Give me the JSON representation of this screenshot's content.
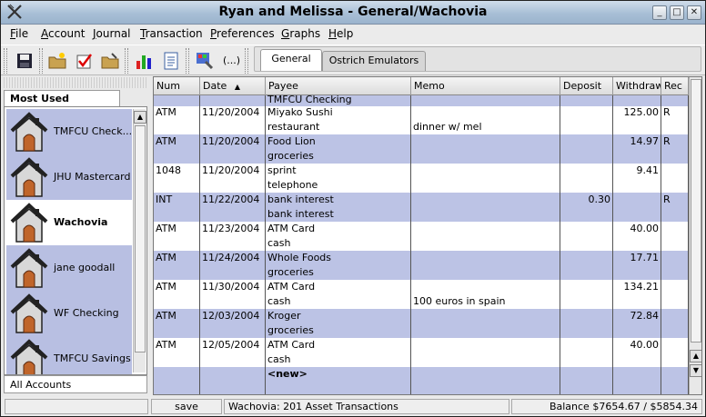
{
  "window": {
    "title": "Ryan and Melissa - General/Wachovia",
    "buttons": [
      "_",
      "□",
      "✕"
    ]
  },
  "menu": [
    {
      "label": "File",
      "u": "F",
      "rest": "ile"
    },
    {
      "label": "Account",
      "u": "A",
      "rest": "ccount"
    },
    {
      "label": "Journal",
      "u": "J",
      "rest": "ournal"
    },
    {
      "label": "Transaction",
      "u": "T",
      "rest": "ransaction"
    },
    {
      "label": "Preferences",
      "u": "P",
      "rest": "references"
    },
    {
      "label": "Graphs",
      "u": "G",
      "rest": "raphs"
    },
    {
      "label": "Help",
      "u": "H",
      "rest": "elp"
    }
  ],
  "toolbar": {
    "ellipsis": "(...)"
  },
  "tabs": [
    "General",
    "Ostrich Emulators"
  ],
  "sidebar": {
    "tab_label": "Most Used",
    "accounts": [
      "TMFCU Check...",
      "JHU Mastercard",
      "Wachovia",
      "jane goodall",
      "WF Checking",
      "TMFCU Savings"
    ],
    "selected": "Wachovia",
    "footer": "All Accounts"
  },
  "register": {
    "columns": [
      "Num",
      "Date",
      "Payee",
      "Memo",
      "Deposit",
      "Withdraw",
      "Rec"
    ],
    "sort_indicator": "▲",
    "partial_top": "TMFCU Checking",
    "rows": [
      {
        "num": "ATM",
        "date": "11/20/2004",
        "payee": "Miyako Sushi",
        "category": "restaurant",
        "memo": "dinner w/ mel",
        "deposit": "",
        "withdraw": "125.00",
        "rec": "R"
      },
      {
        "num": "ATM",
        "date": "11/20/2004",
        "payee": "Food Lion",
        "category": "groceries",
        "memo": "",
        "deposit": "",
        "withdraw": "14.97",
        "rec": "R"
      },
      {
        "num": "1048",
        "date": "11/20/2004",
        "payee": "sprint",
        "category": "telephone",
        "memo": "",
        "deposit": "",
        "withdraw": "9.41",
        "rec": ""
      },
      {
        "num": "INT",
        "date": "11/22/2004",
        "payee": "bank interest",
        "category": "bank interest",
        "memo": "",
        "deposit": "0.30",
        "withdraw": "",
        "rec": "R"
      },
      {
        "num": "ATM",
        "date": "11/23/2004",
        "payee": "ATM Card",
        "category": "cash",
        "memo": "",
        "deposit": "",
        "withdraw": "40.00",
        "rec": ""
      },
      {
        "num": "ATM",
        "date": "11/24/2004",
        "payee": "Whole Foods",
        "category": "groceries",
        "memo": "",
        "deposit": "",
        "withdraw": "17.71",
        "rec": ""
      },
      {
        "num": "ATM",
        "date": "11/30/2004",
        "payee": "ATM Card",
        "category": "cash",
        "memo": "100 euros in spain",
        "deposit": "",
        "withdraw": "134.21",
        "rec": ""
      },
      {
        "num": "ATM",
        "date": "12/03/2004",
        "payee": "Kroger",
        "category": "groceries",
        "memo": "",
        "deposit": "",
        "withdraw": "72.84",
        "rec": ""
      },
      {
        "num": "ATM",
        "date": "12/05/2004",
        "payee": "ATM Card",
        "category": "cash",
        "memo": "",
        "deposit": "",
        "withdraw": "40.00",
        "rec": ""
      }
    ],
    "new_row": "<new>"
  },
  "status": {
    "save": "save",
    "info": "Wachovia: 201 Asset Transactions",
    "balance": "Balance $7654.67 / $5854.34"
  },
  "colors": {
    "row_alt": "#bcc3e5",
    "account_bg": "#b8bfe2",
    "titlebar": "#a8bfd6"
  }
}
